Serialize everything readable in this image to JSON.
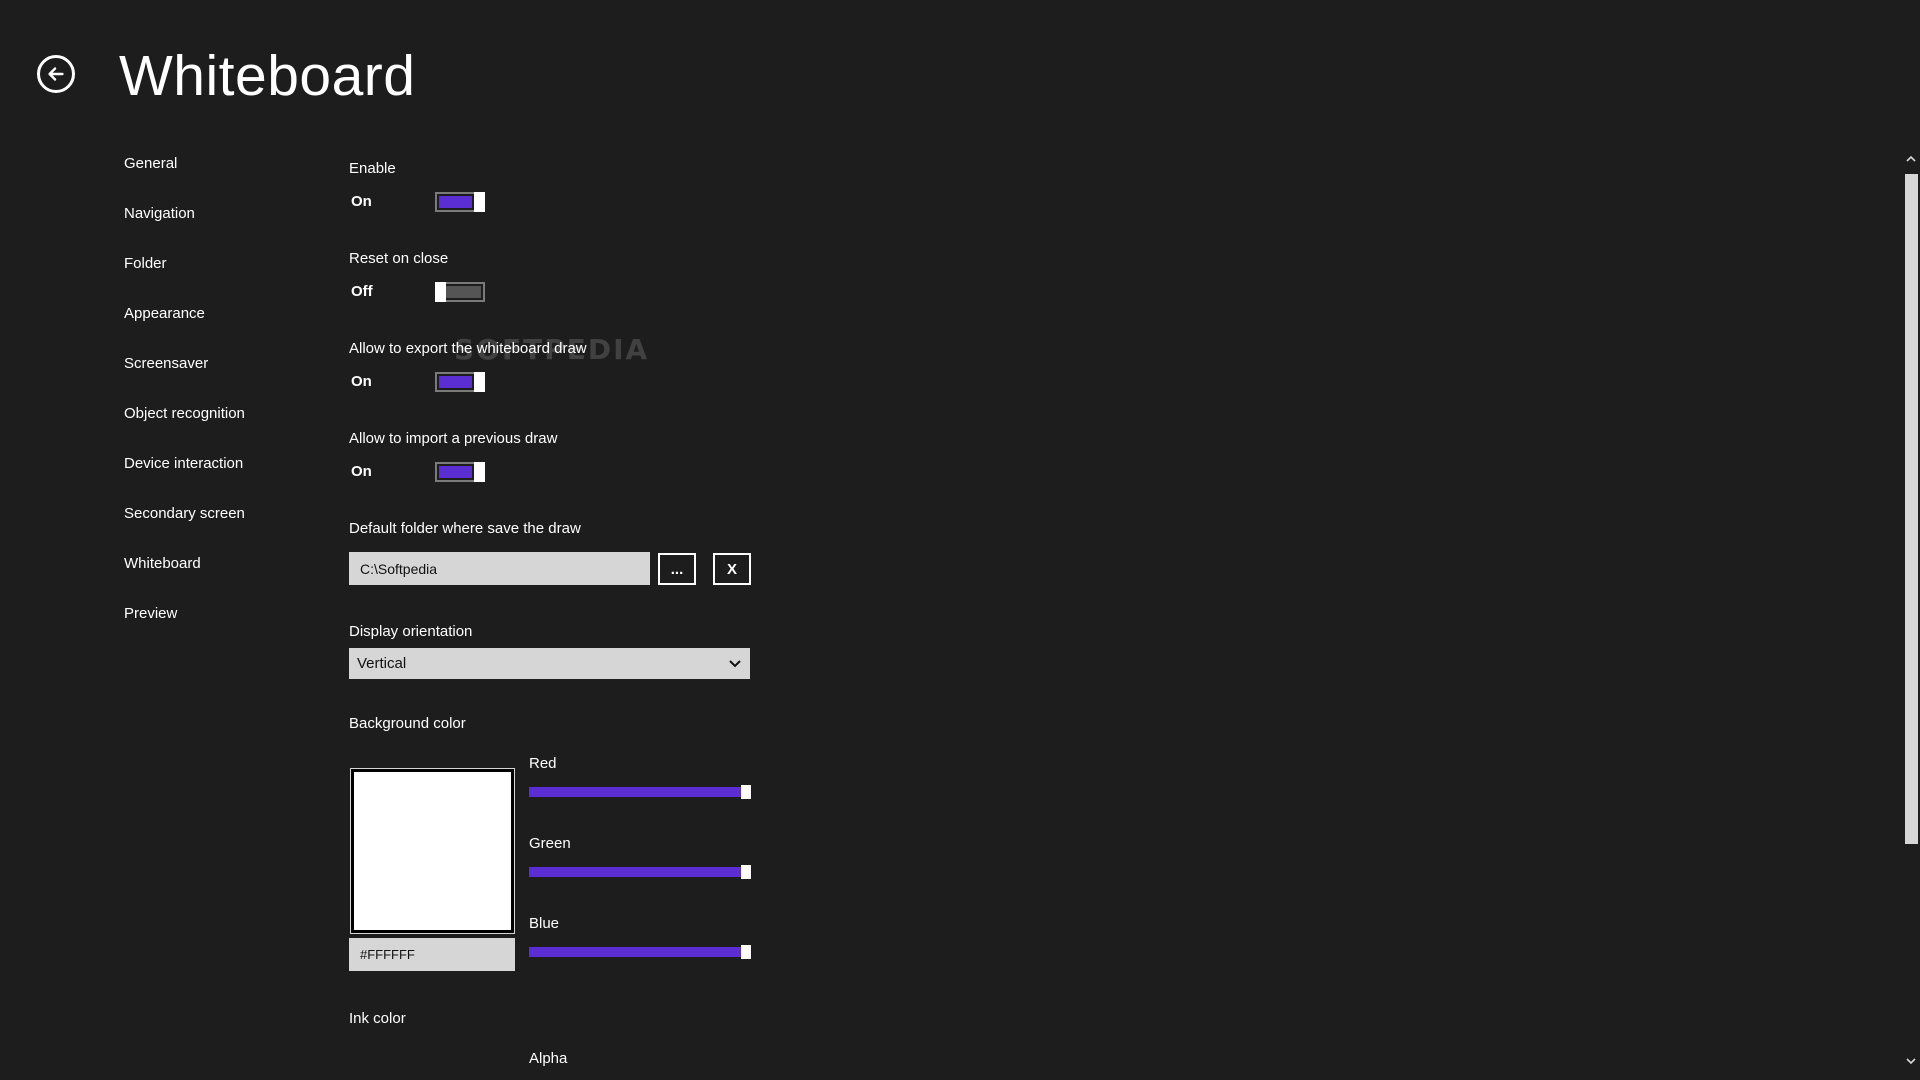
{
  "header": {
    "title": "Whiteboard",
    "back_icon": "back-arrow-icon"
  },
  "sidebar": {
    "items": [
      {
        "label": "General"
      },
      {
        "label": "Navigation"
      },
      {
        "label": "Folder"
      },
      {
        "label": "Appearance"
      },
      {
        "label": "Screensaver"
      },
      {
        "label": "Object recognition"
      },
      {
        "label": "Device interaction"
      },
      {
        "label": "Secondary screen"
      },
      {
        "label": "Whiteboard"
      },
      {
        "label": "Preview"
      }
    ],
    "selected": "Whiteboard"
  },
  "settings": {
    "enable": {
      "label": "Enable",
      "state": "On",
      "value": true
    },
    "reset_on_close": {
      "label": "Reset on close",
      "state": "Off",
      "value": false
    },
    "allow_export": {
      "label": "Allow to export the whiteboard draw",
      "state": "On",
      "value": true
    },
    "allow_import": {
      "label": "Allow to import a previous draw",
      "state": "On",
      "value": true
    },
    "default_folder": {
      "label": "Default folder where save the draw",
      "value": "C:\\Softpedia",
      "browse_label": "...",
      "clear_label": "X"
    },
    "display_orientation": {
      "label": "Display orientation",
      "selected": "Vertical",
      "icon": "chevron-down-icon"
    },
    "background_color": {
      "label": "Background color",
      "hex": "#FFFFFF",
      "swatch_color": "#FFFFFF",
      "red": {
        "label": "Red",
        "value": 255,
        "max": 255
      },
      "green": {
        "label": "Green",
        "value": 255,
        "max": 255
      },
      "blue": {
        "label": "Blue",
        "value": 255,
        "max": 255
      }
    },
    "ink_color": {
      "label": "Ink color",
      "alpha": {
        "label": "Alpha"
      }
    }
  },
  "watermark": "SOFTPEDIA",
  "colors": {
    "background": "#1d1d1d",
    "accent": "#5b2ed4",
    "input_bg": "#d6d6d6",
    "text": "#ffffff"
  }
}
